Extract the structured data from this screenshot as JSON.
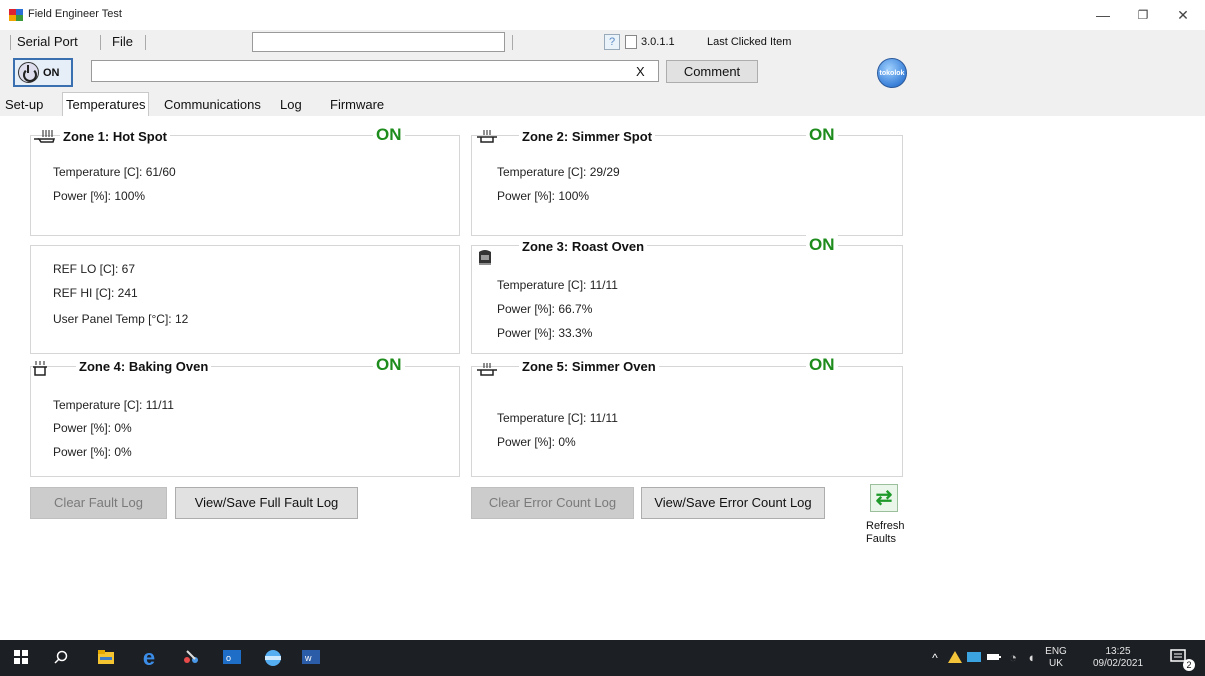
{
  "window": {
    "title": "Field Engineer Test",
    "minimize_glyph": "—",
    "restore_glyph": "❐",
    "close_glyph": "✕"
  },
  "menubar": {
    "items": [
      "Serial Port",
      "File"
    ],
    "help_glyph": "?",
    "version": "3.0.1.1",
    "last_clicked": "Last Clicked Item"
  },
  "toolbar": {
    "on_label": "ON",
    "clear_x": "X",
    "comment_label": "Comment",
    "logo_text": "tokolok"
  },
  "tabs": [
    "Set-up",
    "Temperatures",
    "Communications",
    "Log",
    "Firmware"
  ],
  "active_tab": "Temperatures",
  "zones": {
    "z1": {
      "icon": "pan-icon",
      "title": "Zone 1: Hot Spot",
      "state": "ON",
      "lines": [
        "Temperature [C]: 61/60",
        "Power [%]: 100%"
      ]
    },
    "z2": {
      "icon": "pot-icon",
      "title": "Zone 2: Simmer Spot",
      "state": "ON",
      "lines": [
        "Temperature [C]: 29/29",
        "Power [%]: 100%"
      ]
    },
    "z3": {
      "icon": "oven-icon",
      "title": "Zone 3: Roast Oven",
      "state": "ON",
      "lines": [
        "Temperature [C]: 11/11",
        "Power [%]: 66.7%",
        "Power [%]: 33.3%"
      ]
    },
    "z4": {
      "icon": "oven-icon",
      "title": "Zone 4: Baking Oven",
      "state": "ON",
      "lines": [
        "Temperature [C]: 11/11",
        "Power [%]: 0%",
        "Power [%]: 0%"
      ]
    },
    "z5": {
      "icon": "pot-icon",
      "title": "Zone 5: Simmer Oven",
      "state": "ON",
      "lines": [
        "Temperature [C]: 11/11",
        "Power [%]: 0%"
      ]
    }
  },
  "ref_panel": [
    "REF LO [C]: 67",
    "REF HI [C]: 241",
    "User Panel Temp [°C]: 12"
  ],
  "buttons": {
    "clear_fault": "Clear Fault Log",
    "view_fault": "View/Save Full Fault Log",
    "clear_error": "Clear Error Count Log",
    "view_error": "View/Save Error Count Log",
    "refresh_line1": "Refresh",
    "refresh_line2": "Faults"
  },
  "taskbar": {
    "lang": "ENG",
    "region": "UK",
    "time": "13:25",
    "date": "09/02/2021",
    "notification_count": "2"
  },
  "colors": {
    "on_green": "#1d8c1d",
    "taskbar": "#1c1f24"
  }
}
